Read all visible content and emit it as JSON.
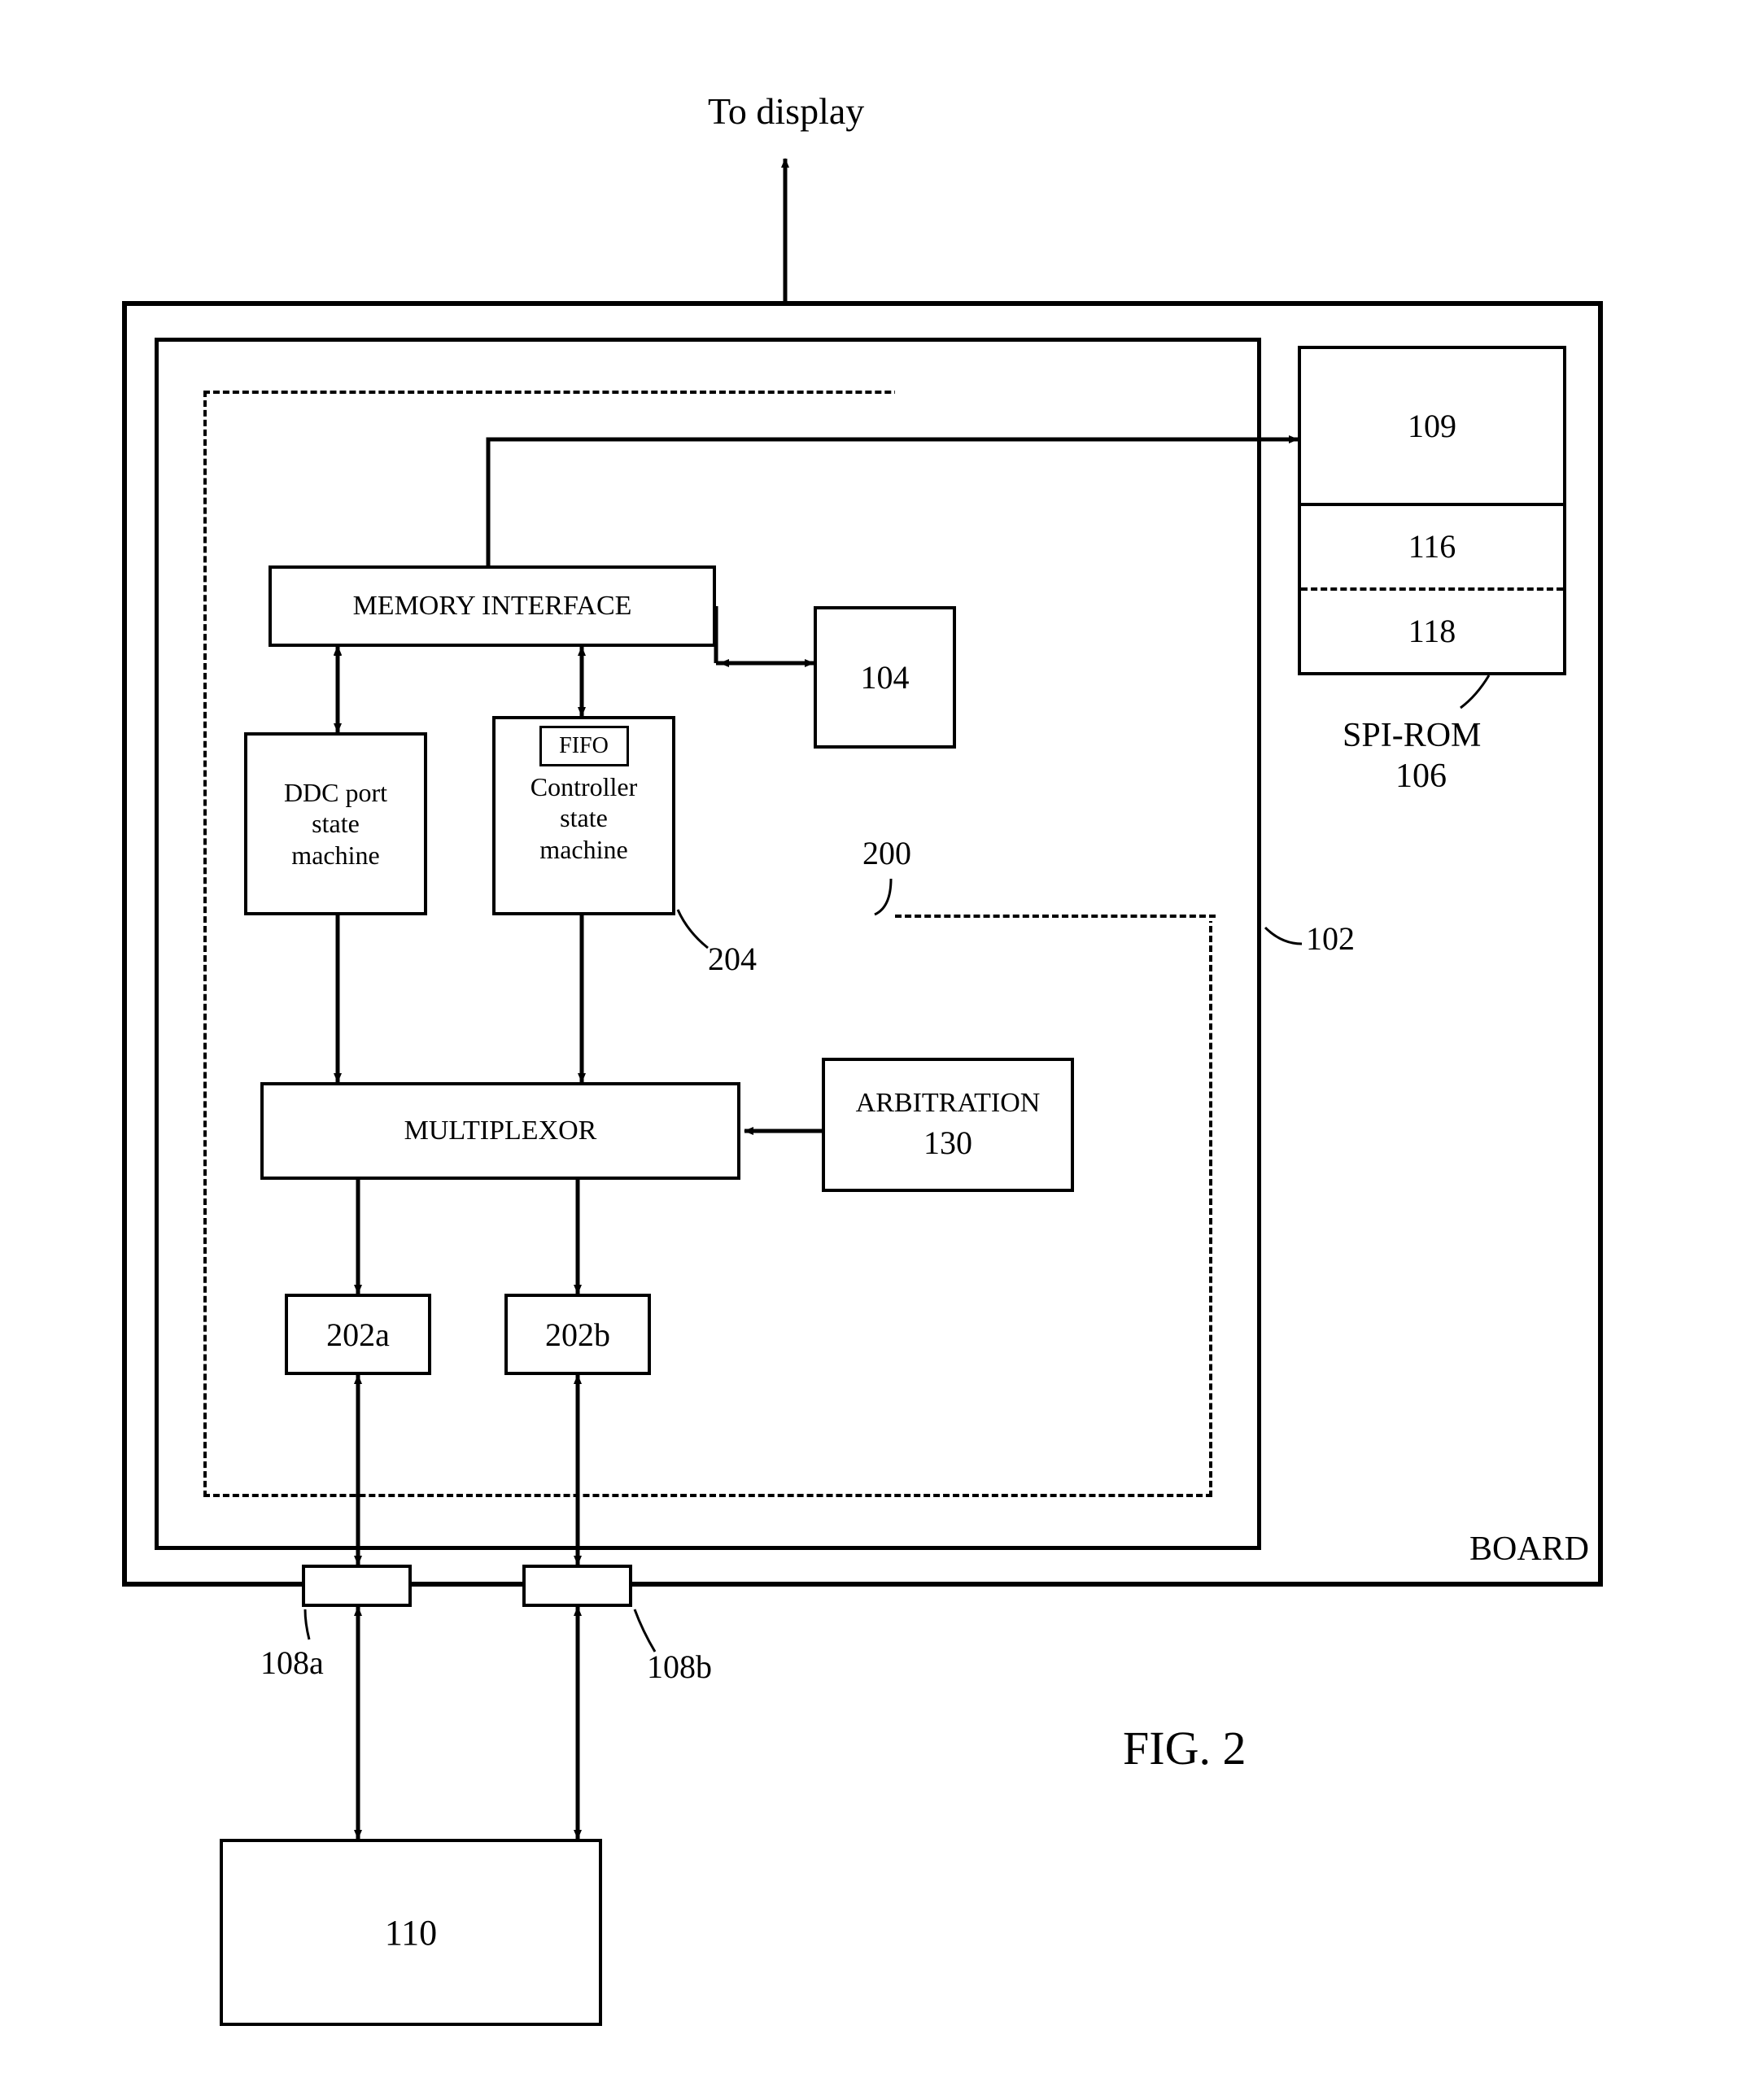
{
  "figure_label": "FIG. 2",
  "top_label": "To display",
  "board_label": "BOARD",
  "spi_rom": {
    "top": "109",
    "mid": "116",
    "bot": "118",
    "caption_a": "SPI-ROM",
    "caption_b": "106"
  },
  "mem_if": "MEMORY INTERFACE",
  "ddc": "DDC port\nstate\nmachine",
  "fifo": "FIFO",
  "controller": "Controller\nstate\nmachine",
  "block_104": "104",
  "ref_200": "200",
  "ref_102": "102",
  "ref_204": "204",
  "mux": "MULTIPLEXOR",
  "arbitration_a": "ARBITRATION",
  "arbitration_b": "130",
  "b202a": "202a",
  "b202b": "202b",
  "ref_108a": "108a",
  "ref_108b": "108b",
  "block_110": "110"
}
